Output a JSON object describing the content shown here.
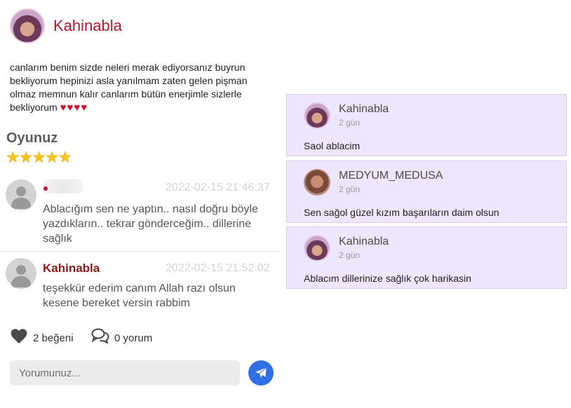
{
  "profile": {
    "name": "Kahinabla",
    "bio": "canlarım benim sizde neleri merak ediyorsanız buyrun bekliyorum hepinizi asla yanılmam zaten gelen pişman olmaz memnun kalır canlarım bütün enerjimle sizlerle bekliyorum",
    "bio_hearts": "♥♥♥♥"
  },
  "rating": {
    "title": "Oyunuz",
    "stars": 5,
    "stars_text": "★★★★★"
  },
  "comments": [
    {
      "author": "",
      "timestamp": "2022-02-15 21:46:37",
      "text_line1": "Ablacığım sen ne yaptın.. nasıl doğru böyle",
      "text_line2": "yazdıkların.. tekrar gönderceğim.. dillerine",
      "text_line3": "sağlık"
    },
    {
      "author": "Kahinabla",
      "timestamp": "2022-02-15 21:52:02",
      "text_line1": "teşekkür ederim canım Allah razı olsun",
      "text_line2": "kesene bereket versin rabbim"
    }
  ],
  "footer": {
    "likes": "2 beğeni",
    "comments": "0 yorum",
    "input_placeholder": "Yorumunuz..."
  },
  "replies": [
    {
      "name": "Kahinabla",
      "time": "2 gün",
      "text": "Saol ablacim"
    },
    {
      "name": "MEDYUM_MEDUSA",
      "time": "2 gün",
      "text": "Sen sağol güzel kızım başarıların daim olsun"
    },
    {
      "name": "Kahinabla",
      "time": "2 gün",
      "text": "Ablacım dillerinize sağlık çok harikasin"
    }
  ],
  "colors": {
    "brand": "#b5172d",
    "send_button": "#2f6fe6",
    "reply_panel": "#eee6fd",
    "stars": "#f3c21c"
  }
}
